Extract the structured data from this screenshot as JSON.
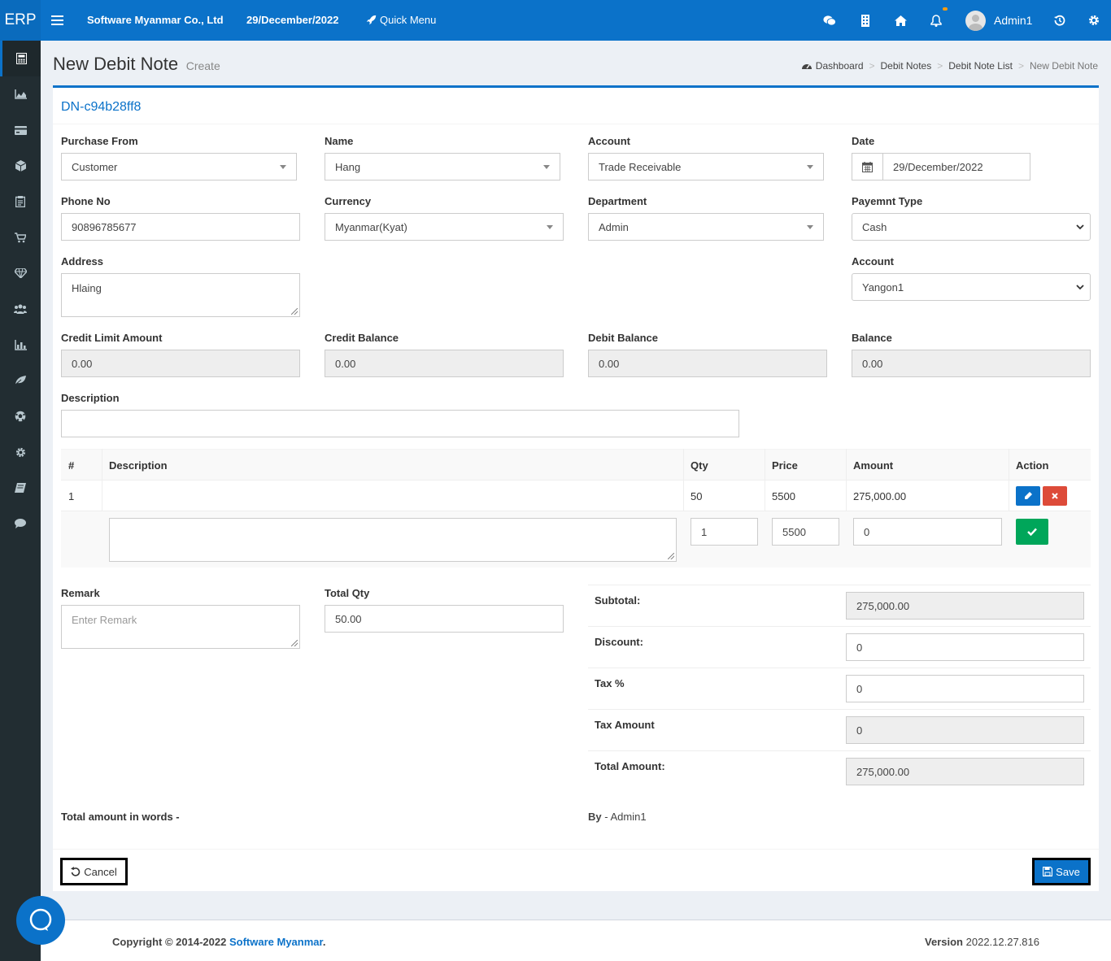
{
  "topbar": {
    "logo": "ERP",
    "company": "Software Myanmar Co., Ltd",
    "date": "29/December/2022",
    "quick_menu": "Quick Menu",
    "user": "Admin1"
  },
  "header": {
    "title": "New Debit Note",
    "subtitle": "Create",
    "breadcrumb": [
      "Dashboard",
      "Debit Notes",
      "Debit Note List",
      "New Debit Note"
    ]
  },
  "form": {
    "doc_no": "DN-c94b28ff8",
    "purchase_from": {
      "label": "Purchase From",
      "value": "Customer"
    },
    "name": {
      "label": "Name",
      "value": "Hang"
    },
    "account": {
      "label": "Account",
      "value": "Trade Receivable"
    },
    "date": {
      "label": "Date",
      "value": "29/December/2022"
    },
    "phone": {
      "label": "Phone No",
      "value": "90896785677"
    },
    "currency": {
      "label": "Currency",
      "value": "Myanmar(Kyat)"
    },
    "department": {
      "label": "Department",
      "value": "Admin"
    },
    "payment_type": {
      "label": "Payemnt Type",
      "value": "Cash"
    },
    "address": {
      "label": "Address",
      "value": "Hlaing"
    },
    "account2": {
      "label": "Account",
      "value": "Yangon1"
    },
    "credit_limit": {
      "label": "Credit Limit Amount",
      "value": "0.00"
    },
    "credit_balance": {
      "label": "Credit Balance",
      "value": "0.00"
    },
    "debit_balance": {
      "label": "Debit Balance",
      "value": "0.00"
    },
    "balance": {
      "label": "Balance",
      "value": "0.00"
    },
    "description": {
      "label": "Description",
      "value": ""
    }
  },
  "table": {
    "headers": [
      "#",
      "Description",
      "Qty",
      "Price",
      "Amount",
      "Action"
    ],
    "rows": [
      {
        "no": "1",
        "description": "",
        "qty": "50",
        "price": "5500",
        "amount": "275,000.00"
      }
    ],
    "edit": {
      "description": "",
      "qty": "1",
      "price": "5500",
      "amount": "0"
    }
  },
  "remark": {
    "label": "Remark",
    "placeholder": "Enter Remark"
  },
  "total_qty": {
    "label": "Total Qty",
    "value": "50.00"
  },
  "summary": {
    "subtotal": {
      "label": "Subtotal:",
      "value": "275,000.00"
    },
    "discount": {
      "label": "Discount:",
      "value": "0"
    },
    "tax_pct": {
      "label": "Tax %",
      "value": "0"
    },
    "tax_amount": {
      "label": "Tax Amount",
      "value": "0"
    },
    "total_amount": {
      "label": "Total Amount:",
      "value": "275,000.00"
    }
  },
  "words": {
    "label": "Total amount in words -",
    "value": ""
  },
  "by": {
    "label": "By",
    "value": "- Admin1"
  },
  "buttons": {
    "cancel": "Cancel",
    "save": "Save"
  },
  "footer": {
    "copyright": "Copyright © 2014-2022",
    "company_link": "Software Myanmar",
    "version_label": "Version",
    "version": "2022.12.27.816"
  },
  "sidebar": {
    "items": [
      "calculator-icon",
      "area-chart-icon",
      "credit-card-icon",
      "cube-icon",
      "clipboard-icon",
      "cart-icon",
      "diamond-icon",
      "users-icon",
      "bar-chart-icon",
      "leaf-icon",
      "soccer-icon",
      "cog-icon",
      "book-icon",
      "comment-icon"
    ]
  },
  "colors": {
    "primary": "#0b72c9",
    "sidebar": "#222d32",
    "danger": "#dd4b39",
    "success": "#00a65a"
  }
}
